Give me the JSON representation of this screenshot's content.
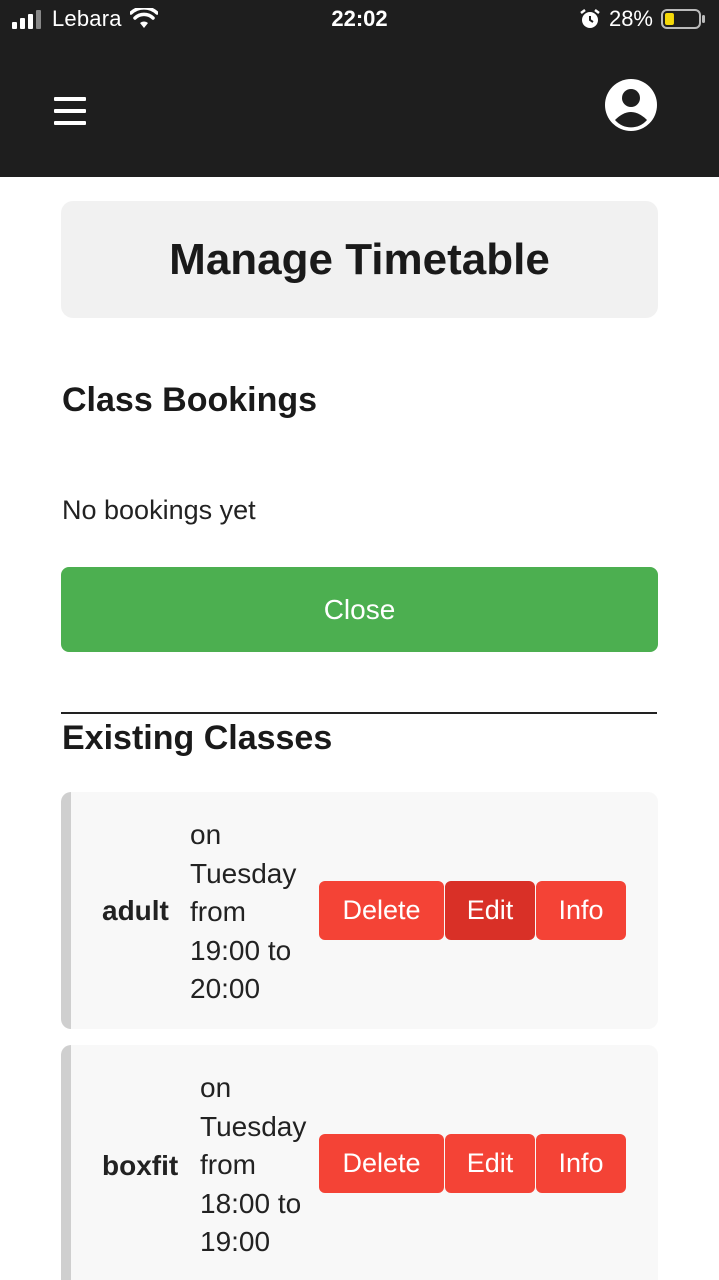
{
  "status_bar": {
    "carrier": "Lebara",
    "time": "22:02",
    "battery": "28%",
    "battery_level": 0.28,
    "icons": [
      "signal-icon",
      "wifi-icon",
      "alarm-icon",
      "battery-icon"
    ]
  },
  "header": {
    "menu_icon": "hamburger-menu-icon",
    "profile_icon": "user-account-icon",
    "background": "#1e1e1e"
  },
  "page": {
    "title": "Manage Timetable"
  },
  "bookings": {
    "heading": "Class Bookings",
    "empty_message": "No bookings yet",
    "close_label": "Close",
    "close_color": "#4caf50"
  },
  "classes": {
    "heading": "Existing Classes",
    "items": [
      {
        "name": "adult",
        "line1": "on",
        "line2": "Tuesday",
        "line3": "from",
        "line4": "19:00 to",
        "line5": "20:00",
        "delete_label": "Delete",
        "edit_label": "Edit",
        "info_label": "Info"
      },
      {
        "name": "boxfit",
        "line1": "on",
        "line2": "Tuesday",
        "line3": "from",
        "line4": "18:00 to",
        "line5": "19:00",
        "delete_label": "Delete",
        "edit_label": "Edit",
        "info_label": "Info"
      }
    ],
    "button_color": "#f44336"
  }
}
